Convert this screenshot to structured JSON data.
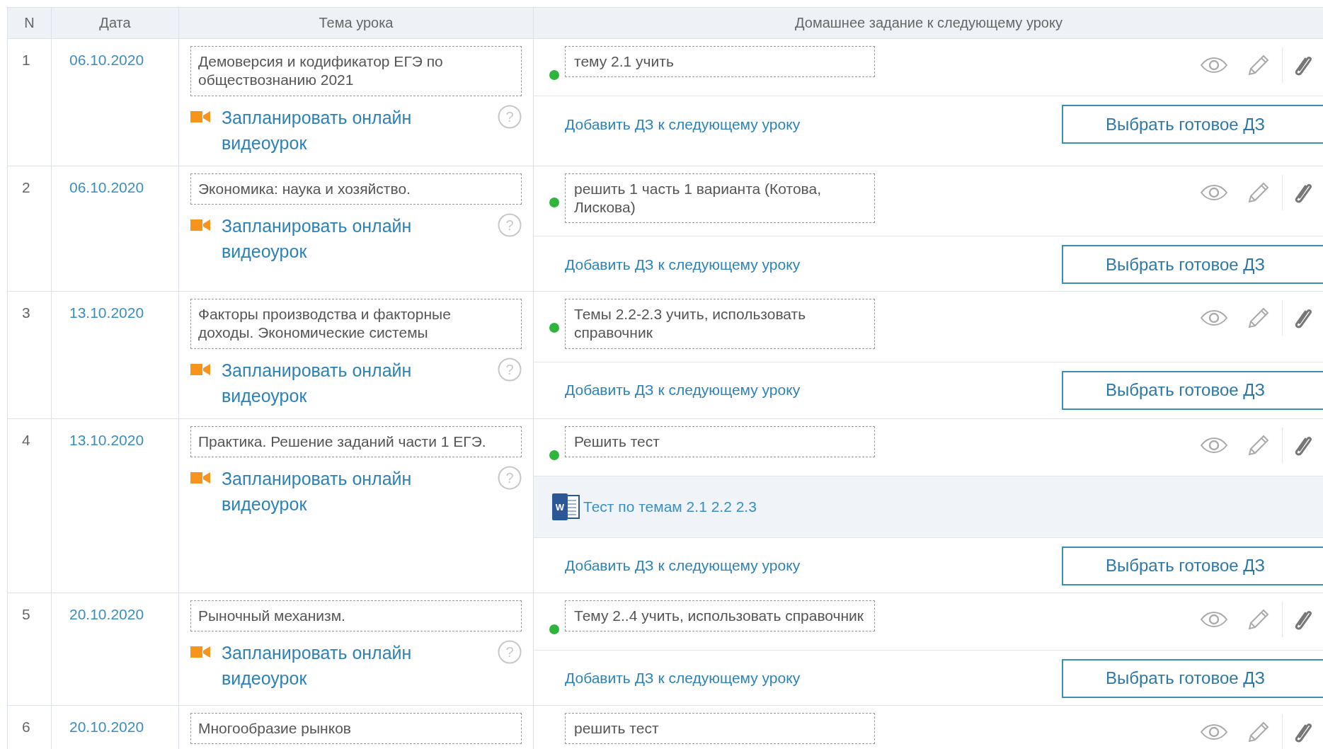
{
  "help_mark": "?",
  "table": {
    "columns": [
      "N",
      "Дата",
      "Тема урока",
      "Домашнее задание к следующему уроку"
    ],
    "rows": [
      {
        "n": "1",
        "date": "06.10.2020",
        "topic": "Демоверсия и кодификатор ЕГЭ по обществознанию 2021",
        "video_link": "Запланировать онлайн видеоурок",
        "homework": "тему 2.1 учить",
        "color": "#2fb43c",
        "attachments": [],
        "add_link": "Добавить ДЗ к следующему уроку",
        "choose_button": "Выбрать готовое ДЗ"
      },
      {
        "n": "2",
        "date": "06.10.2020",
        "topic": "Экономика: наука и хозяйство.",
        "video_link": "Запланировать онлайн видеоурок",
        "homework": "решить 1 часть 1 варианта (Котова, Лискова)",
        "color": "#2fb43c",
        "attachments": [],
        "add_link": "Добавить ДЗ к следующему уроку",
        "choose_button": "Выбрать готовое ДЗ"
      },
      {
        "n": "3",
        "date": "13.10.2020",
        "topic": "Факторы производства и факторные доходы. Экономические системы",
        "video_link": "Запланировать онлайн видеоурок",
        "homework": "Темы 2.2-2.3 учить, использовать справочник",
        "color": "#2fb43c",
        "attachments": [],
        "add_link": "Добавить ДЗ к следующему уроку",
        "choose_button": "Выбрать готовое ДЗ"
      },
      {
        "n": "4",
        "date": "13.10.2020",
        "topic": "Практика. Решение заданий части 1 ЕГЭ.",
        "video_link": "Запланировать онлайн видеоурок",
        "homework": "Решить тест",
        "color": "#2fb43c",
        "attachments": [
          {
            "kind": "word",
            "icon_letter": "W",
            "name": "Тест по темам 2.1 2.2 2.3"
          }
        ],
        "add_link": "Добавить ДЗ к следующему уроку",
        "choose_button": "Выбрать готовое ДЗ"
      },
      {
        "n": "5",
        "date": "20.10.2020",
        "topic": "Рыночный механизм.",
        "video_link": "Запланировать онлайн видеоурок",
        "homework": "Тему 2..4 учить, использовать справочник",
        "color": "#2fb43c",
        "attachments": [],
        "add_link": "Добавить ДЗ к следующему уроку",
        "choose_button": "Выбрать готовое ДЗ"
      },
      {
        "n": "6",
        "date": "20.10.2020",
        "topic": "Многообразие рынков",
        "homework": "решить тест",
        "attachments": []
      }
    ]
  }
}
